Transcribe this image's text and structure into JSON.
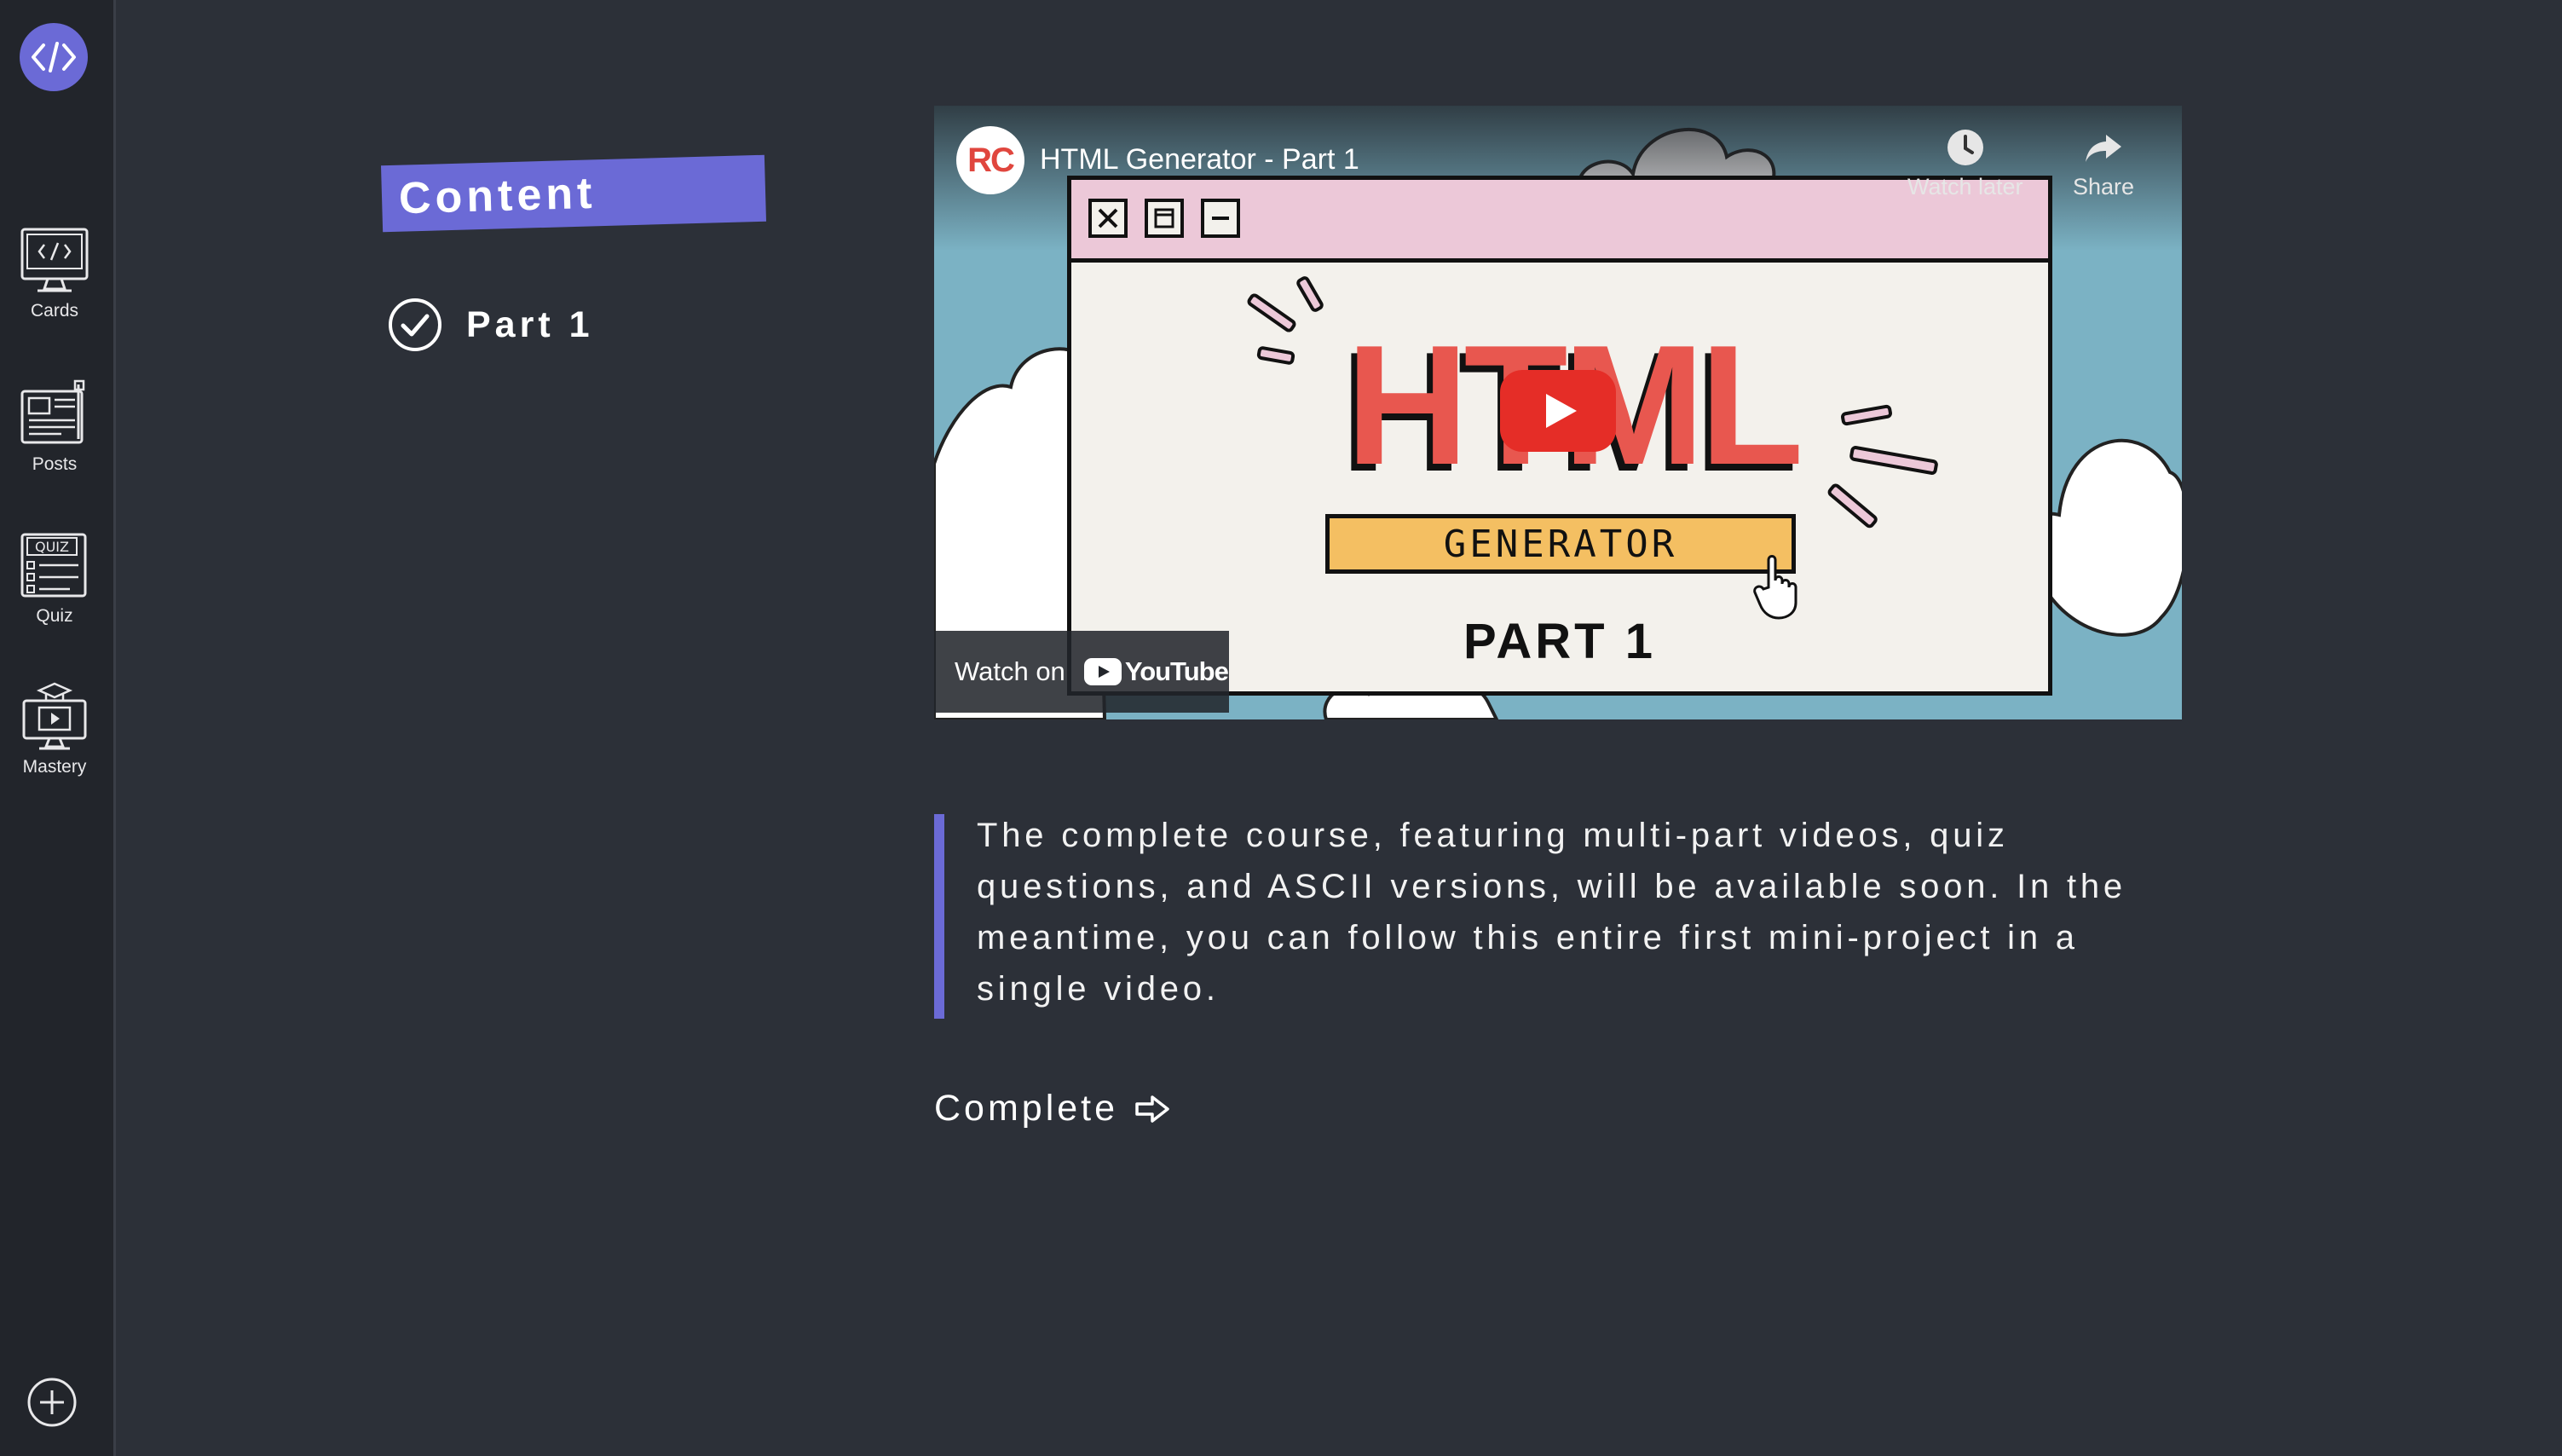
{
  "sidebar": {
    "items": [
      {
        "label": "Cards",
        "icon": "code-screen-icon"
      },
      {
        "label": "Posts",
        "icon": "newspaper-icon"
      },
      {
        "label": "Quiz",
        "icon": "quiz-sheet-icon"
      },
      {
        "label": "Mastery",
        "icon": "mastery-monitor-icon"
      }
    ]
  },
  "content": {
    "heading": "Content",
    "parts": [
      {
        "label": "Part 1",
        "completed": true
      }
    ]
  },
  "video": {
    "title": "HTML Generator - Part 1",
    "channel_initials": "RC",
    "watch_later": "Watch later",
    "share": "Share",
    "watch_on": "Watch on",
    "youtube": "YouTube",
    "thumbnail": {
      "headline": "HTML",
      "subheadline": "GENERATOR",
      "part": "PART 1"
    }
  },
  "description": "The complete course, featuring multi-part videos, quiz questions, and ASCII versions, will be available soon. In the meantime, you can follow this entire first mini-project in a single video.",
  "complete_label": "Complete",
  "colors": {
    "accent": "#6b6ad6",
    "background": "#2c3038",
    "sidebar": "#22252b"
  }
}
